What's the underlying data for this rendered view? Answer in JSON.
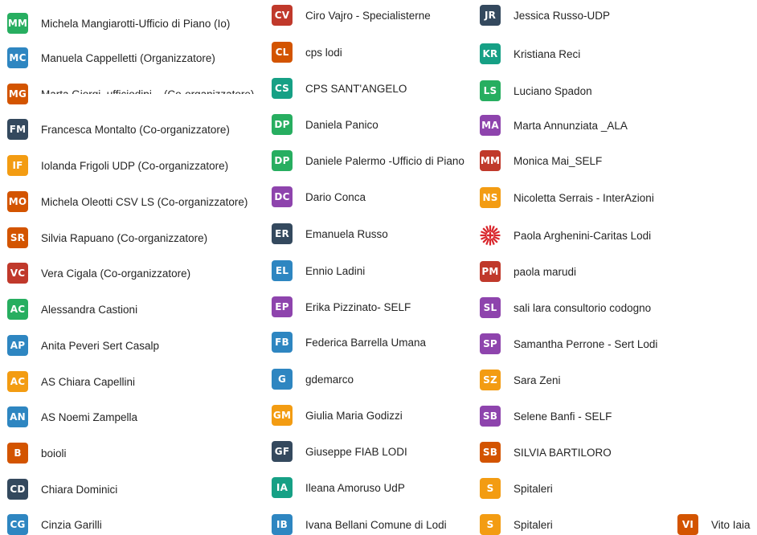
{
  "participants": [
    {
      "initials": "MM",
      "name": "Michela Mangiarotti-Ufficio di Piano (Io)",
      "color": "#27ae60"
    },
    {
      "initials": "MC",
      "name": "Manuela Cappelletti (Organizzatore)",
      "color": "#2e86c1"
    },
    {
      "initials": "MG",
      "name": "Marta Giorgi_ufficiodipi... (Co-organizzatore)",
      "color": "#d35400"
    },
    {
      "initials": "FM",
      "name": "Francesca Montalto (Co-organizzatore)",
      "color": "#34495e"
    },
    {
      "initials": "IF",
      "name": "Iolanda Frigoli UDP (Co-organizzatore)",
      "color": "#f39c12"
    },
    {
      "initials": "MO",
      "name": "Michela Oleotti CSV LS (Co-organizzatore)",
      "color": "#d35400"
    },
    {
      "initials": "SR",
      "name": "Silvia Rapuano (Co-organizzatore)",
      "color": "#d35400"
    },
    {
      "initials": "VC",
      "name": "Vera Cigala (Co-organizzatore)",
      "color": "#c0392b"
    },
    {
      "initials": "AC",
      "name": "Alessandra Castioni",
      "color": "#27ae60"
    },
    {
      "initials": "AP",
      "name": "Anita Peveri Sert Casalp",
      "color": "#2e86c1"
    },
    {
      "initials": "AC",
      "name": "AS Chiara Capellini",
      "color": "#f39c12"
    },
    {
      "initials": "AN",
      "name": "AS Noemi Zampella",
      "color": "#2e86c1"
    },
    {
      "initials": "B",
      "name": "boioli",
      "color": "#d35400"
    },
    {
      "initials": "CD",
      "name": "Chiara Dominici",
      "color": "#34495e"
    },
    {
      "initials": "CG",
      "name": "Cinzia Garilli",
      "color": "#2e86c1"
    },
    {
      "initials": "CV",
      "name": "Ciro Vajro - Specialisterne",
      "color": "#c0392b"
    },
    {
      "initials": "CL",
      "name": "cps lodi",
      "color": "#d35400"
    },
    {
      "initials": "CS",
      "name": "CPS SANT'ANGELO",
      "color": "#16a085"
    },
    {
      "initials": "DP",
      "name": "Daniela Panico",
      "color": "#27ae60"
    },
    {
      "initials": "DP",
      "name": "Daniele Palermo -Ufficio di Piano",
      "color": "#27ae60"
    },
    {
      "initials": "DC",
      "name": "Dario Conca",
      "color": "#8e44ad"
    },
    {
      "initials": "ER",
      "name": "Emanuela Russo",
      "color": "#34495e"
    },
    {
      "initials": "EL",
      "name": "Ennio Ladini",
      "color": "#2e86c1"
    },
    {
      "initials": "EP",
      "name": "Erika Pizzinato- SELF",
      "color": "#8e44ad"
    },
    {
      "initials": "FB",
      "name": "Federica Barrella Umana",
      "color": "#2e86c1"
    },
    {
      "initials": "G",
      "name": "gdemarco",
      "color": "#2e86c1"
    },
    {
      "initials": "GM",
      "name": "Giulia Maria Godizzi",
      "color": "#f39c12"
    },
    {
      "initials": "GF",
      "name": "Giuseppe FIAB LODI",
      "color": "#34495e"
    },
    {
      "initials": "IA",
      "name": "Ileana Amoruso UdP",
      "color": "#16a085"
    },
    {
      "initials": "IB",
      "name": "Ivana Bellani Comune di Lodi",
      "color": "#2e86c1"
    },
    {
      "initials": "JR",
      "name": "Jessica Russo-UDP",
      "color": "#34495e"
    },
    {
      "initials": "KR",
      "name": "Kristiana Reci",
      "color": "#16a085"
    },
    {
      "initials": "LS",
      "name": "Luciano Spadon",
      "color": "#27ae60"
    },
    {
      "initials": "MA",
      "name": "Marta Annunziata _ALA",
      "color": "#8e44ad"
    },
    {
      "initials": "MM",
      "name": "Monica Mai_SELF",
      "color": "#c0392b"
    },
    {
      "initials": "NS",
      "name": "Nicoletta Serrais - InterAzioni",
      "color": "#f39c12"
    },
    {
      "initials": "",
      "name": "Paola Arghenini-Caritas Lodi",
      "color": "#d9252b",
      "logo": "caritas-logo"
    },
    {
      "initials": "PM",
      "name": "paola marudi",
      "color": "#c0392b"
    },
    {
      "initials": "SL",
      "name": "sali lara consultorio codogno",
      "color": "#8e44ad"
    },
    {
      "initials": "SP",
      "name": "Samantha Perrone - Sert Lodi",
      "color": "#8e44ad"
    },
    {
      "initials": "SZ",
      "name": "Sara Zeni",
      "color": "#f39c12"
    },
    {
      "initials": "SB",
      "name": "Selene Banfi - SELF",
      "color": "#8e44ad"
    },
    {
      "initials": "SB",
      "name": "SILVIA BARTILORO",
      "color": "#d35400"
    },
    {
      "initials": "S",
      "name": "Spitaleri",
      "color": "#f39c12"
    },
    {
      "initials": "S",
      "name": "Spitaleri",
      "color": "#f39c12"
    },
    {
      "initials": "VI",
      "name": "Vito Iaia",
      "color": "#d35400"
    }
  ]
}
